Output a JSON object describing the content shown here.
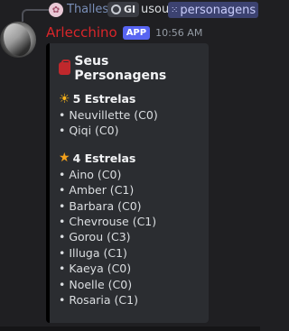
{
  "reply": {
    "user_name": "Thalles",
    "chip_label": "GI",
    "verb": "usou",
    "command": "personagens"
  },
  "message": {
    "author": "Arlecchino",
    "badge": "APP",
    "time": "10:56 AM"
  },
  "embed": {
    "title": "Seus Personagens",
    "sections": [
      {
        "title": "5 Estrelas",
        "items": [
          "• Neuvillette (C0)",
          "• Qiqi (C0)"
        ]
      },
      {
        "title": "4 Estrelas",
        "items": [
          "• Aino (C0)",
          "• Amber (C1)",
          "• Barbara (C0)",
          "• Chevrouse (C1)",
          "• Gorou (C3)",
          "• Illuga (C1)",
          "• Kaeya (C0)",
          "• Noelle (C0)",
          "• Rosaria (C1)"
        ]
      }
    ]
  },
  "colors": {
    "author": "#d9262a",
    "app_badge": "#5865f2",
    "embed_border": "#000000"
  }
}
